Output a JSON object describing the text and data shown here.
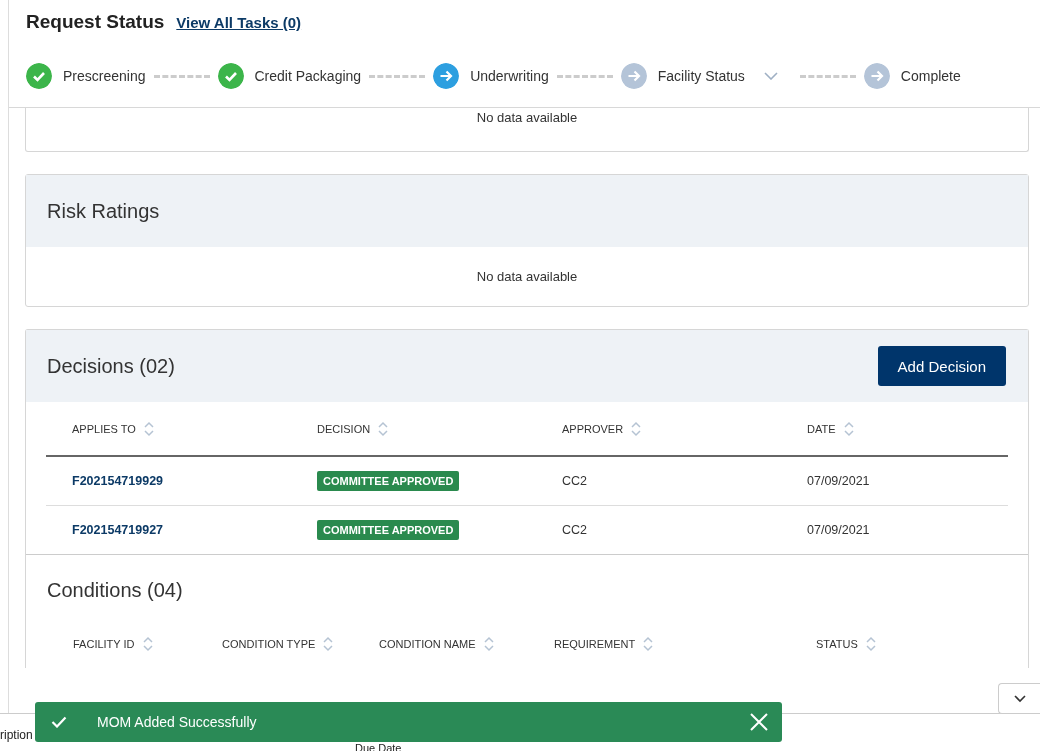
{
  "header": {
    "title": "Request Status",
    "link": "View All Tasks (0)"
  },
  "steps": [
    {
      "label": "Prescreening",
      "completed": true,
      "current": false,
      "has_menu": false
    },
    {
      "label": "Credit Packaging",
      "completed": true,
      "current": false,
      "has_menu": false
    },
    {
      "label": "Underwriting",
      "completed": false,
      "current": true,
      "has_menu": false
    },
    {
      "label": "Facility Status",
      "completed": false,
      "current": false,
      "has_menu": true
    },
    {
      "label": "Complete",
      "completed": false,
      "current": false,
      "has_menu": false
    }
  ],
  "top_card": {
    "message": "No data available"
  },
  "risk_ratings": {
    "title": "Risk Ratings",
    "message": "No data available"
  },
  "decisions": {
    "title": "Decisions (02)",
    "button": "Add Decision",
    "columns": [
      "APPLIES TO",
      "DECISION",
      "APPROVER",
      "DATE"
    ],
    "rows": [
      {
        "applies_to": "F202154719929",
        "decision": "COMMITTEE APPROVED",
        "approver": "CC2",
        "date": "07/09/2021"
      },
      {
        "applies_to": "F202154719927",
        "decision": "COMMITTEE APPROVED",
        "approver": "CC2",
        "date": "07/09/2021"
      }
    ]
  },
  "conditions": {
    "title": "Conditions (04)",
    "columns": [
      "FACILITY ID",
      "CONDITION TYPE",
      "CONDITION NAME",
      "REQUIREMENT",
      "STATUS"
    ]
  },
  "toast": {
    "message": "MOM Added Successfully"
  },
  "footer": {
    "text_1": "ription",
    "text_2": "Due Date"
  }
}
